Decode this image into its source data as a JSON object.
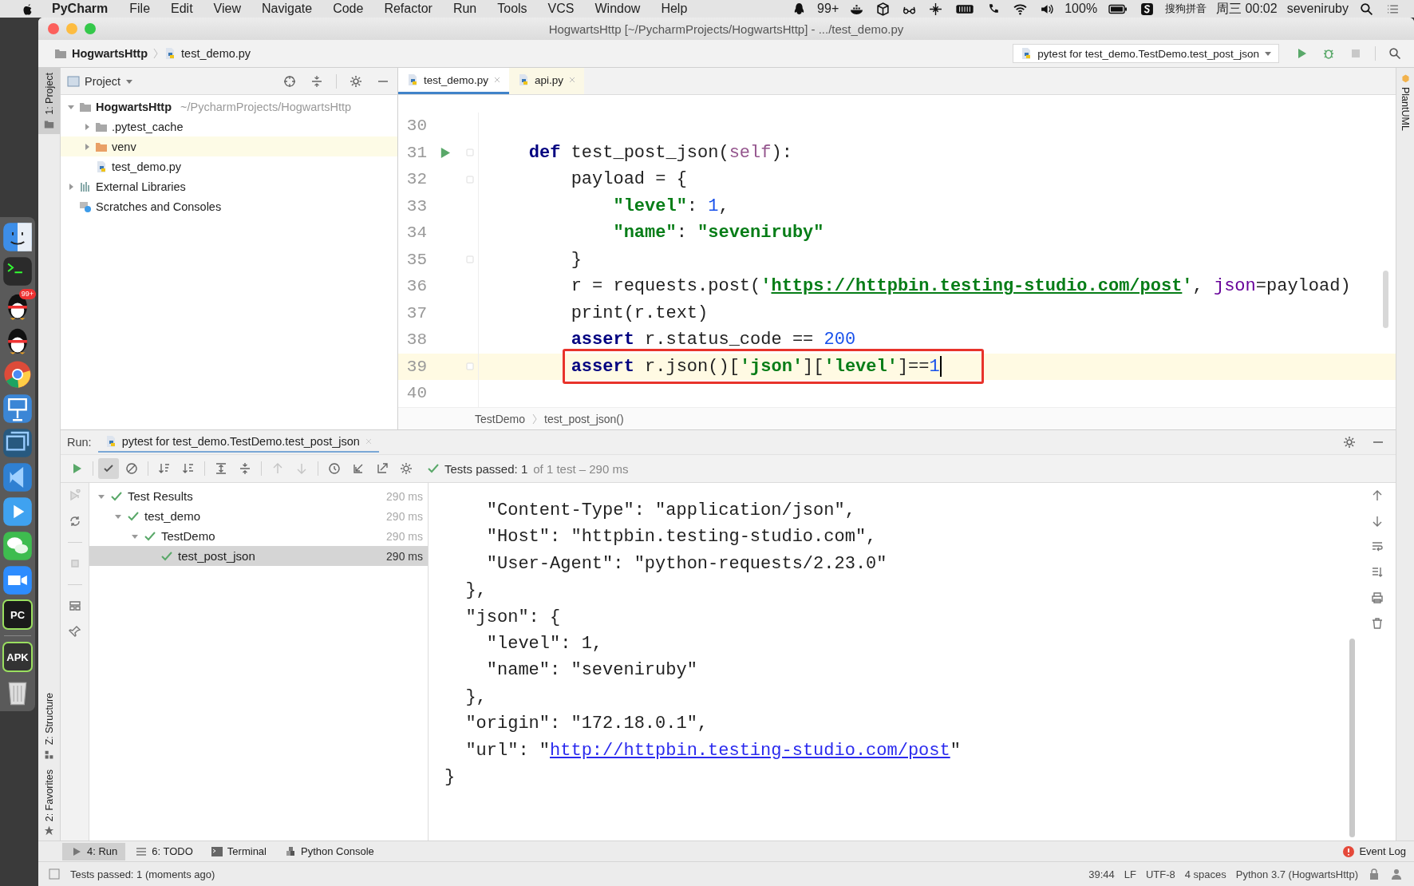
{
  "menubar": {
    "app": "PyCharm",
    "menus": [
      "File",
      "Edit",
      "View",
      "Navigate",
      "Code",
      "Refactor",
      "Run",
      "Tools",
      "VCS",
      "Window",
      "Help"
    ],
    "notifications": "99+",
    "battery": "100%",
    "input_method": "搜狗拼音",
    "clock": "周三 00:02",
    "user": "seveniruby"
  },
  "dock": [
    {
      "kind": "finder"
    },
    {
      "kind": "terminal"
    },
    {
      "kind": "qq",
      "badge": "99+"
    },
    {
      "kind": "qq"
    },
    {
      "kind": "chrome"
    },
    {
      "kind": "keynote"
    },
    {
      "kind": "photos"
    },
    {
      "kind": "vscode"
    },
    {
      "kind": "tencent"
    },
    {
      "kind": "wechat"
    },
    {
      "kind": "zoom"
    },
    {
      "kind": "pycharm",
      "label": "PC"
    },
    {
      "kind": "apk",
      "label": "APK"
    },
    {
      "kind": "trash"
    }
  ],
  "window": {
    "title": "HogwartsHttp [~/PycharmProjects/HogwartsHttp] - .../test_demo.py"
  },
  "navbar": {
    "crumbs": [
      "HogwartsHttp",
      "test_demo.py"
    ],
    "run_config": "pytest for test_demo.TestDemo.test_post_json"
  },
  "tool_strips": {
    "left_top": "1: Project",
    "left_bottom": [
      "Z: Structure",
      "2: Favorites"
    ],
    "right": "PlantUML"
  },
  "project": {
    "title": "Project",
    "tree": [
      {
        "name": "HogwartsHttp",
        "kind": "project",
        "path": "~/PycharmProjects/HogwartsHttp",
        "expanded": true,
        "children": [
          {
            "name": ".pytest_cache",
            "kind": "folder",
            "expanded": false,
            "excluded": false
          },
          {
            "name": "venv",
            "kind": "folder",
            "expanded": false,
            "excluded": true
          },
          {
            "name": "test_demo.py",
            "kind": "file"
          }
        ]
      },
      {
        "name": "External Libraries",
        "kind": "libraries",
        "expanded": false
      },
      {
        "name": "Scratches and Consoles",
        "kind": "scratches"
      }
    ]
  },
  "editor": {
    "tabs": [
      {
        "label": "test_demo.py",
        "selected": true
      },
      {
        "label": "api.py",
        "selected": false
      }
    ],
    "lines": [
      {
        "number": "30"
      },
      {
        "number": "31",
        "run": true,
        "fold": true,
        "tokens": [
          {
            "kind": "keyword",
            "text": "    def"
          },
          {
            "kind": "plain",
            "text": " test_post_json("
          },
          {
            "kind": "self",
            "text": "self"
          },
          {
            "kind": "plain",
            "text": "):"
          }
        ]
      },
      {
        "number": "32",
        "fold": true,
        "tokens": [
          {
            "kind": "plain",
            "text": "        payload = {"
          }
        ]
      },
      {
        "number": "33",
        "tokens": [
          {
            "kind": "string",
            "text": "            \"level\""
          },
          {
            "kind": "plain",
            "text": ": "
          },
          {
            "kind": "number",
            "text": "1"
          },
          {
            "kind": "plain",
            "text": ","
          }
        ]
      },
      {
        "number": "34",
        "tokens": [
          {
            "kind": "string",
            "text": "            \"name\""
          },
          {
            "kind": "plain",
            "text": ": "
          },
          {
            "kind": "string",
            "text": "\"seveniruby\""
          }
        ]
      },
      {
        "number": "35",
        "fold": true,
        "tokens": [
          {
            "kind": "plain",
            "text": "        }"
          }
        ]
      },
      {
        "number": "36",
        "tokens": [
          {
            "kind": "plain",
            "text": "        r = requests.post("
          },
          {
            "kind": "string",
            "text": "'"
          },
          {
            "kind": "link",
            "text": "https://httpbin.testing-studio.com/post"
          },
          {
            "kind": "string",
            "text": "'"
          },
          {
            "kind": "plain",
            "text": ", "
          },
          {
            "kind": "param",
            "text": "json"
          },
          {
            "kind": "plain",
            "text": "=payload)"
          }
        ]
      },
      {
        "number": "37",
        "tokens": [
          {
            "kind": "plain",
            "text": "        print(r.text)"
          }
        ]
      },
      {
        "number": "38",
        "tokens": [
          {
            "kind": "keyword",
            "text": "        assert"
          },
          {
            "kind": "plain",
            "text": " r.status_code == "
          },
          {
            "kind": "number",
            "text": "200"
          }
        ]
      },
      {
        "number": "39",
        "fold": true,
        "current": true,
        "boxed": true,
        "tokens": [
          {
            "kind": "keyword",
            "text": "        assert"
          },
          {
            "kind": "plain",
            "text": " r.json()["
          },
          {
            "kind": "string",
            "text": "'json'"
          },
          {
            "kind": "plain",
            "text": "]["
          },
          {
            "kind": "string",
            "text": "'level'"
          },
          {
            "kind": "plain",
            "text": "]=="
          },
          {
            "kind": "number",
            "text": "1"
          }
        ]
      },
      {
        "number": "40"
      }
    ],
    "breadcrumbs": [
      "TestDemo",
      "test_post_json()"
    ]
  },
  "run": {
    "label": "Run:",
    "tab": "pytest for test_demo.TestDemo.test_post_json",
    "show_passed": true,
    "status": {
      "passed": "Tests passed: 1",
      "detail": "of 1 test – 290 ms"
    },
    "tests": [
      {
        "name": "Test Results",
        "time": "290 ms",
        "passed": true,
        "expanded": true,
        "selected": false,
        "children": [
          {
            "name": "test_demo",
            "time": "290 ms",
            "passed": true,
            "expanded": true,
            "selected": false,
            "children": [
              {
                "name": "TestDemo",
                "time": "290 ms",
                "passed": true,
                "expanded": true,
                "selected": false,
                "children": [
                  {
                    "name": "test_post_json",
                    "time": "290 ms",
                    "passed": true,
                    "selected": true
                  }
                ]
              }
            ]
          }
        ]
      }
    ],
    "console": [
      [
        {
          "kind": "plain",
          "text": "    \"Content-Type\": \"application/json\","
        }
      ],
      [
        {
          "kind": "plain",
          "text": "    \"Host\": \"httpbin.testing-studio.com\","
        }
      ],
      [
        {
          "kind": "plain",
          "text": "    \"User-Agent\": \"python-requests/2.23.0\""
        }
      ],
      [
        {
          "kind": "plain",
          "text": "  },"
        }
      ],
      [
        {
          "kind": "plain",
          "text": "  \"json\": {"
        }
      ],
      [
        {
          "kind": "plain",
          "text": "    \"level\": 1,"
        }
      ],
      [
        {
          "kind": "plain",
          "text": "    \"name\": \"seveniruby\""
        }
      ],
      [
        {
          "kind": "plain",
          "text": "  },"
        }
      ],
      [
        {
          "kind": "plain",
          "text": "  \"origin\": \"172.18.0.1\","
        }
      ],
      [
        {
          "kind": "plain",
          "text": "  \"url\": \""
        },
        {
          "kind": "link",
          "text": "http://httpbin.testing-studio.com/post"
        },
        {
          "kind": "plain",
          "text": "\""
        }
      ],
      [
        {
          "kind": "plain",
          "text": "}"
        }
      ]
    ]
  },
  "bottom_tabs": [
    {
      "label": "4: Run",
      "selected": true
    },
    {
      "label": "6: TODO",
      "selected": false
    },
    {
      "label": "Terminal",
      "selected": false
    },
    {
      "label": "Python Console",
      "selected": false
    }
  ],
  "event_log": "Event Log",
  "status_bar": {
    "message": "Tests passed: 1 (moments ago)",
    "items": [
      "39:44",
      "LF",
      "UTF-8",
      "4 spaces",
      "Python 3.7 (HogwartsHttp)"
    ]
  }
}
